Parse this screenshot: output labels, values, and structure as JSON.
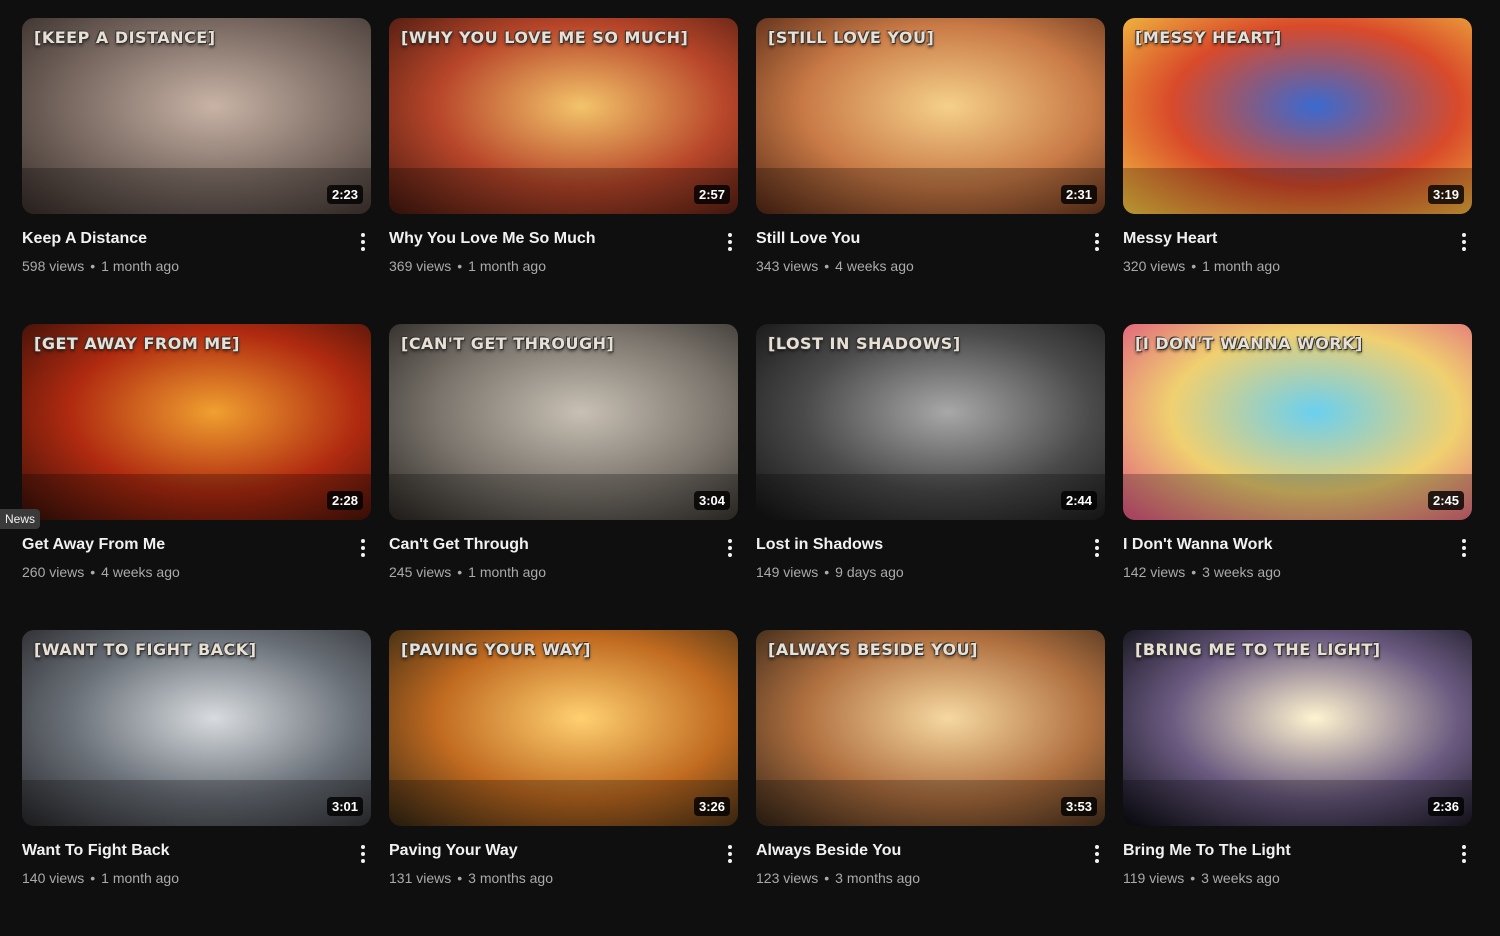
{
  "tooltip": "News",
  "videos": [
    {
      "thumb_text": "[KEEP A DISTANCE]",
      "duration": "2:23",
      "title": "Keep A Distance",
      "views": "598 views",
      "age": "1 month ago"
    },
    {
      "thumb_text": "[WHY YOU LOVE ME SO MUCH]",
      "duration": "2:57",
      "title": "Why You Love Me So Much",
      "views": "369 views",
      "age": "1 month ago"
    },
    {
      "thumb_text": "[STILL LOVE YOU]",
      "duration": "2:31",
      "title": "Still Love You",
      "views": "343 views",
      "age": "4 weeks ago"
    },
    {
      "thumb_text": "[MESSY HEART]",
      "duration": "3:19",
      "title": "Messy Heart",
      "views": "320 views",
      "age": "1 month ago"
    },
    {
      "thumb_text": "[GET AWAY FROM ME]",
      "duration": "2:28",
      "title": "Get Away From Me",
      "views": "260 views",
      "age": "4 weeks ago"
    },
    {
      "thumb_text": "[CAN'T GET THROUGH]",
      "duration": "3:04",
      "title": "Can't Get Through",
      "views": "245 views",
      "age": "1 month ago"
    },
    {
      "thumb_text": "[LOST IN SHADOWS]",
      "duration": "2:44",
      "title": "Lost in Shadows",
      "views": "149 views",
      "age": "9 days ago"
    },
    {
      "thumb_text": "[I DON'T WANNA WORK]",
      "duration": "2:45",
      "title": "I Don't Wanna Work",
      "views": "142 views",
      "age": "3 weeks ago"
    },
    {
      "thumb_text": "[WANT TO FIGHT BACK]",
      "duration": "3:01",
      "title": "Want To Fight Back",
      "views": "140 views",
      "age": "1 month ago"
    },
    {
      "thumb_text": "[PAVING YOUR WAY]",
      "duration": "3:26",
      "title": "Paving Your Way",
      "views": "131 views",
      "age": "3 months ago"
    },
    {
      "thumb_text": "[ALWAYS BESIDE YOU]",
      "duration": "3:53",
      "title": "Always Beside You",
      "views": "123 views",
      "age": "3 months ago"
    },
    {
      "thumb_text": "[BRING ME TO THE LIGHT]",
      "duration": "2:36",
      "title": "Bring Me To The Light",
      "views": "119 views",
      "age": "3 weeks ago"
    }
  ],
  "thumb_palettes": [
    [
      "#c9b3a6",
      "#7a6a62",
      "#3a302c"
    ],
    [
      "#f3c46a",
      "#b8462a",
      "#4a1a10"
    ],
    [
      "#f5d08a",
      "#c97a46",
      "#5a2c18"
    ],
    [
      "#3a6ad0",
      "#d94a2a",
      "#f2c040"
    ],
    [
      "#f0a030",
      "#b02a10",
      "#3a1008"
    ],
    [
      "#c8c0b4",
      "#7a746c",
      "#2e2a26"
    ],
    [
      "#a8a8a8",
      "#4a4a4a",
      "#151515"
    ],
    [
      "#6ad0f0",
      "#f0d070",
      "#e05a80"
    ],
    [
      "#d8dce0",
      "#6a7078",
      "#2a2a2e"
    ],
    [
      "#ffd070",
      "#c06a20",
      "#3a2a14"
    ],
    [
      "#f6d8a0",
      "#b07040",
      "#3a2818"
    ],
    [
      "#fff4d0",
      "#6a5a80",
      "#101018"
    ]
  ]
}
